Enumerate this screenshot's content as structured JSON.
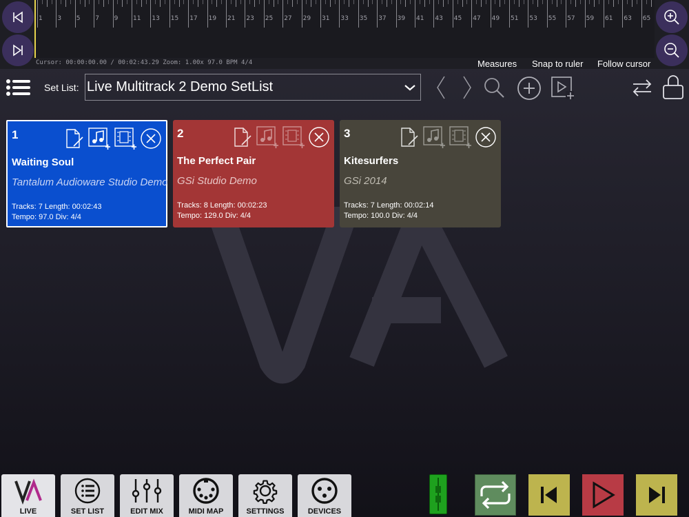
{
  "ruler": {
    "labels": [
      "1",
      "3",
      "5",
      "7",
      "9",
      "11",
      "13",
      "15",
      "17",
      "19",
      "21",
      "23",
      "25",
      "27",
      "29",
      "31",
      "33",
      "35",
      "37",
      "39",
      "41",
      "43",
      "45",
      "47",
      "49",
      "51",
      "53",
      "55",
      "57",
      "59",
      "61",
      "63",
      "65"
    ],
    "cursor_info": "Cursor: 00:00:00.00 / 00:02:43.29 Zoom: 1.00x 97.0 BPM 4/4",
    "options": [
      "Measures",
      "Snap to ruler",
      "Follow cursor"
    ]
  },
  "toolbar": {
    "setlist_label": "Set List:",
    "setlist_value": "Live Multitrack 2 Demo SetList"
  },
  "songs": [
    {
      "num": "1",
      "title": "Waiting Soul",
      "artist": "Tantalum Audioware Studio Demo",
      "info1": "Tracks: 7 Length: 00:02:43",
      "info2": "Tempo: 97.0 Div: 4/4",
      "color": "#0a4fcf",
      "artist_color": "#c8d4f4",
      "selected": true
    },
    {
      "num": "2",
      "title": "The Perfect Pair",
      "artist": "GSi Studio Demo",
      "info1": "Tracks: 8 Length: 00:02:23",
      "info2": "Tempo: 129.0 Div: 4/4",
      "color": "#a33636",
      "artist_color": "#e8c6c6",
      "selected": false
    },
    {
      "num": "3",
      "title": "Kitesurfers",
      "artist": "GSi 2014",
      "info1": "Tracks: 7 Length: 00:02:14",
      "info2": "Tempo: 100.0 Div: 4/4",
      "color": "#48453b",
      "artist_color": "#c0bdb3",
      "selected": false
    }
  ],
  "tabs": [
    {
      "id": "live",
      "label": "LIVE",
      "icon": "live-logo-icon"
    },
    {
      "id": "set-list",
      "label": "SET LIST",
      "icon": "list-icon"
    },
    {
      "id": "edit-mix",
      "label": "EDIT MIX",
      "icon": "mixer-sliders-icon"
    },
    {
      "id": "midi-map",
      "label": "MIDI MAP",
      "icon": "midi-port-icon"
    },
    {
      "id": "settings",
      "label": "SETTINGS",
      "icon": "gear-icon"
    },
    {
      "id": "devices",
      "label": "DEVICES",
      "icon": "xlr-connector-icon"
    }
  ],
  "colors": {
    "loop": "#5f8c5e",
    "prev": "#bdb44e",
    "play": "#b83b45",
    "next": "#bdb44e",
    "meter": "#1ea11e",
    "accent": "#3b2f5c"
  }
}
